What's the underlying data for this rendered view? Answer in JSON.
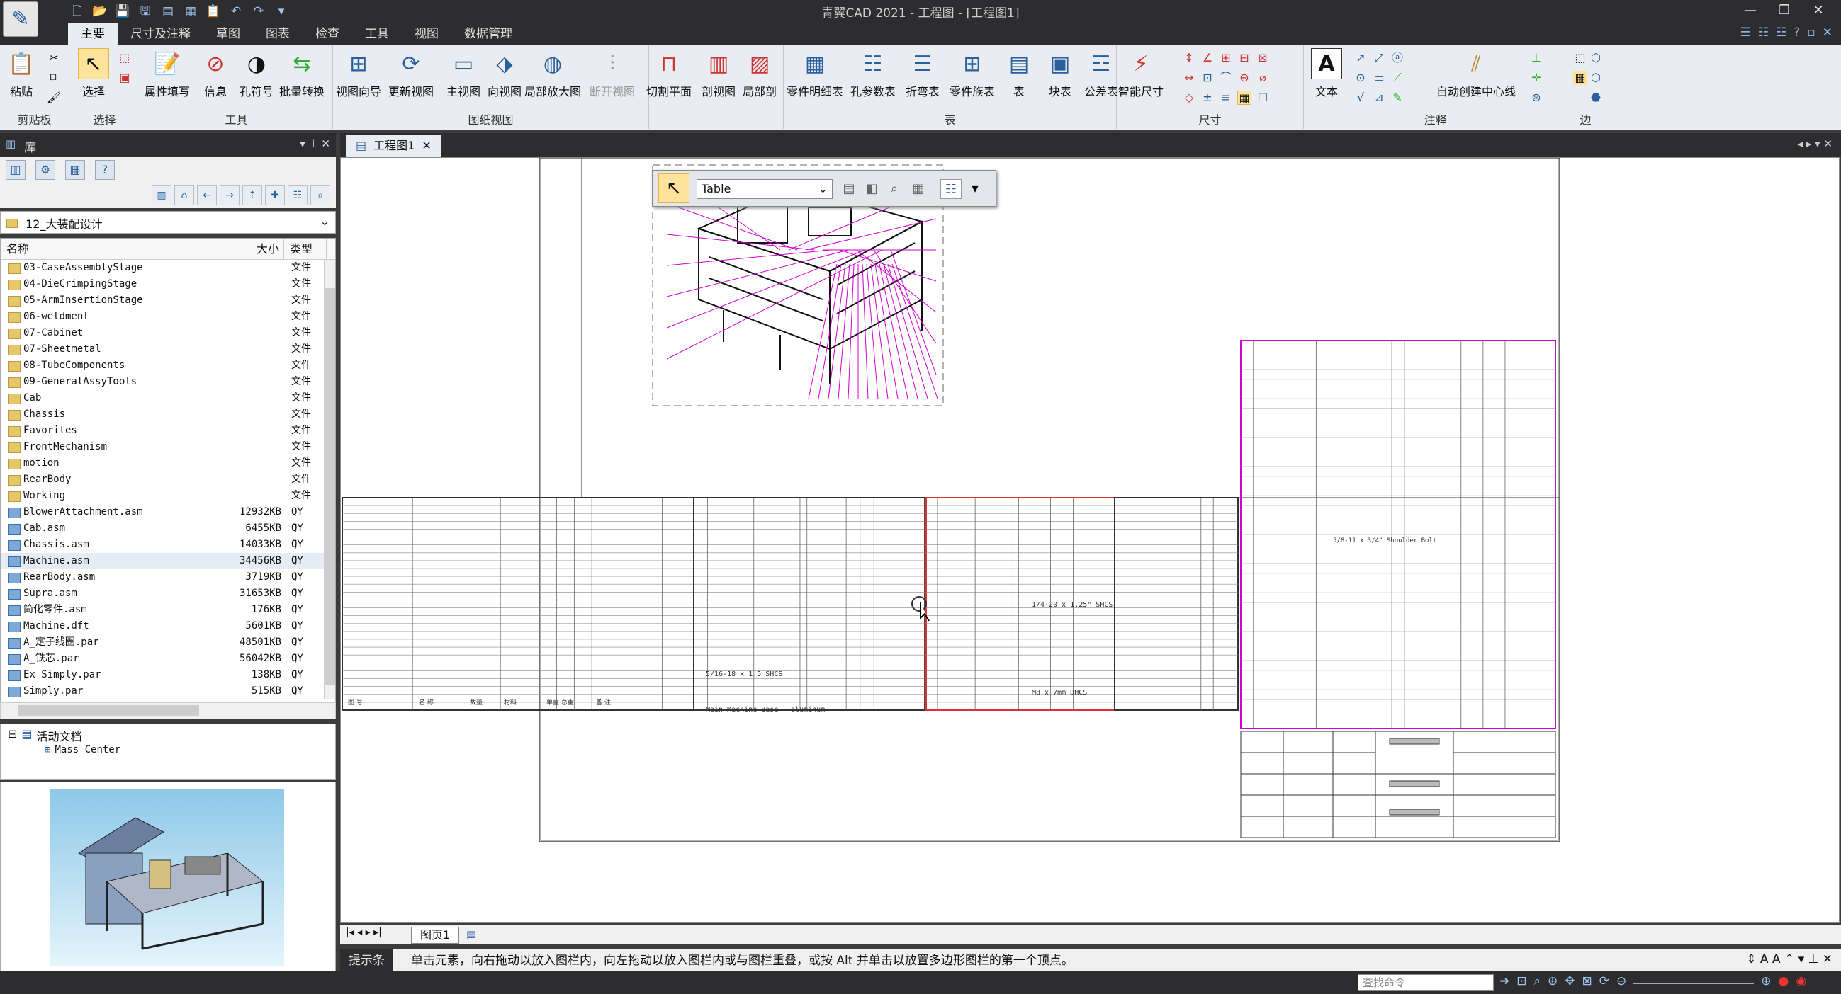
{
  "window": {
    "title": "青翼CAD 2021 - 工程图 - [工程图1]"
  },
  "menu": {
    "tabs": [
      "主要",
      "尺寸及注释",
      "草图",
      "图表",
      "检查",
      "工具",
      "视图",
      "数据管理"
    ]
  },
  "ribbon": {
    "groups": [
      "剪贴板",
      "选择",
      "工具",
      "图纸视图",
      "表",
      "尺寸",
      "注释",
      "边"
    ],
    "buttons": {
      "paste": "粘贴",
      "select": "选择",
      "attr_fill": "属性填写",
      "info": "信息",
      "hole_no": "孔符号",
      "batch": "批量转换",
      "view_wizard": "视图向导",
      "update_view": "更新视图",
      "main_view": "主视图",
      "proj_view": "向视图",
      "detail_view": "局部放大图",
      "break_view": "断开视图",
      "cut_plane": "切割平面",
      "section_view": "剖视图",
      "partial_section": "局部剖",
      "parts_list": "零件明细表",
      "hole_table": "孔参数表",
      "bend_table": "折弯表",
      "family_table": "零件族表",
      "table": "表",
      "block_table": "块表",
      "tol_table": "公差表",
      "smart_dim": "智能尺寸",
      "text": "文本",
      "auto_center": "自动创建中心线"
    }
  },
  "library": {
    "title": "库",
    "folder": "12_大装配设计",
    "columns": [
      "名称",
      "大小",
      "类型"
    ],
    "files": [
      {
        "name": "03-CaseAssemblyStage",
        "size": "",
        "type": "文件"
      },
      {
        "name": "04-DieCrimpingStage",
        "size": "",
        "type": "文件"
      },
      {
        "name": "05-ArmInsertionStage",
        "size": "",
        "type": "文件"
      },
      {
        "name": "06-weldment",
        "size": "",
        "type": "文件"
      },
      {
        "name": "07-Cabinet",
        "size": "",
        "type": "文件"
      },
      {
        "name": "07-Sheetmetal",
        "size": "",
        "type": "文件"
      },
      {
        "name": "08-TubeComponents",
        "size": "",
        "type": "文件"
      },
      {
        "name": "09-GeneralAssyTools",
        "size": "",
        "type": "文件"
      },
      {
        "name": "Cab",
        "size": "",
        "type": "文件"
      },
      {
        "name": "Chassis",
        "size": "",
        "type": "文件"
      },
      {
        "name": "Favorites",
        "size": "",
        "type": "文件"
      },
      {
        "name": "FrontMechanism",
        "size": "",
        "type": "文件"
      },
      {
        "name": "motion",
        "size": "",
        "type": "文件"
      },
      {
        "name": "RearBody",
        "size": "",
        "type": "文件"
      },
      {
        "name": "Working",
        "size": "",
        "type": "文件"
      },
      {
        "name": "BlowerAttachment.asm",
        "size": "12932KB",
        "type": "QY C"
      },
      {
        "name": "Cab.asm",
        "size": "6455KB",
        "type": "QY C"
      },
      {
        "name": "Chassis.asm",
        "size": "14033KB",
        "type": "QY C"
      },
      {
        "name": "Machine.asm",
        "size": "34456KB",
        "type": "QY C"
      },
      {
        "name": "RearBody.asm",
        "size": "3719KB",
        "type": "QY C"
      },
      {
        "name": "Supra.asm",
        "size": "31653KB",
        "type": "QY C"
      },
      {
        "name": "简化零件.asm",
        "size": "176KB",
        "type": "QY C"
      },
      {
        "name": "Machine.dft",
        "size": "5601KB",
        "type": "QY C"
      },
      {
        "name": "A_定子线圈.par",
        "size": "48501KB",
        "type": "QY C"
      },
      {
        "name": "A_铁芯.par",
        "size": "56042KB",
        "type": "QY C"
      },
      {
        "name": "Ex_Simply.par",
        "size": "138KB",
        "type": "QY C"
      },
      {
        "name": "Simply.par",
        "size": "515KB",
        "type": "QY C"
      }
    ],
    "tree": {
      "root": "活动文档",
      "child": "Mass Center"
    }
  },
  "document": {
    "tab": "工程图1",
    "sheet": "图页1"
  },
  "float_toolbar": {
    "combo_value": "Table"
  },
  "status": {
    "label": "提示条",
    "text": "单击元素，向右拖动以放入图栏内，向左拖动以放入图栏内或与图栏重叠，或按 Alt 并单击以放置多边形图栏的第一个顶点。"
  },
  "bottom": {
    "cmd_placeholder": "查找命令"
  },
  "drawing": {
    "table_footer": [
      "图 号",
      "名 称",
      "数量",
      "材料",
      "单重 总重",
      "备 注"
    ],
    "note1": "M8 x 7mm DHCS",
    "note2": "1/4-20 x 1.25\" SHCS",
    "note3": "5/16-18 x 1.5 SHCS",
    "note4": "Main Machine Base",
    "note5": "aluminum",
    "note6": "5/8-11 x 3/4\" Shoulder Bolt"
  }
}
